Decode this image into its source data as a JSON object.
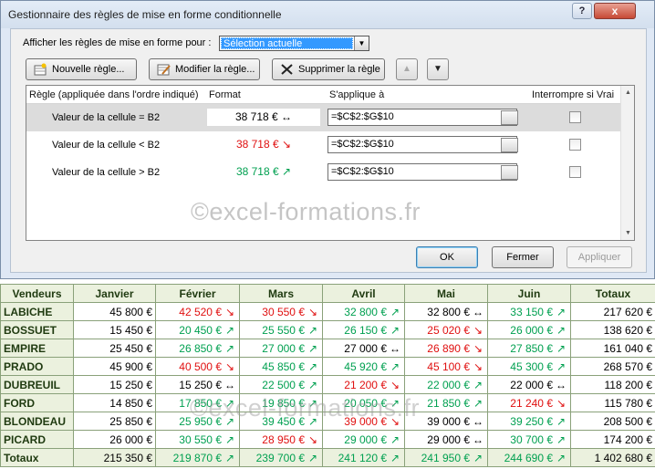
{
  "dialog": {
    "title": "Gestionnaire des règles de mise en forme conditionnelle",
    "help_label": "?",
    "close_label": "x",
    "show_rules_label": "Afficher les règles de mise en forme pour :",
    "show_rules_value": "Sélection actuelle",
    "buttons": {
      "new_rule": "Nouvelle règle...",
      "edit_rule": "Modifier la règle...",
      "delete_rule": "Supprimer la règle",
      "ok": "OK",
      "close": "Fermer",
      "apply": "Appliquer"
    },
    "columns": {
      "rule": "Règle (appliquée dans l'ordre indiqué)",
      "format": "Format",
      "applies_to": "S'applique à",
      "stop_if_true": "Interrompre si Vrai"
    },
    "rules": [
      {
        "rule": "Valeur de la cellule = B2",
        "format_text": "38 718 € ↔",
        "format_color": "#000000",
        "applies_to": "=$C$2:$G$10"
      },
      {
        "rule": "Valeur de la cellule < B2",
        "format_text": "38 718 € ↘",
        "format_color": "#e01010",
        "applies_to": "=$C$2:$G$10"
      },
      {
        "rule": "Valeur de la cellule > B2",
        "format_text": "38 718 € ↗",
        "format_color": "#00a050",
        "applies_to": "=$C$2:$G$10"
      }
    ]
  },
  "watermark": "©excel-formations.fr",
  "table": {
    "headers": [
      "Vendeurs",
      "Janvier",
      "Février",
      "Mars",
      "Avril",
      "Mai",
      "Juin",
      "Totaux"
    ],
    "rows": [
      {
        "name": "LABICHE",
        "cells": [
          [
            "45 800 €",
            ""
          ],
          [
            "42 520 €",
            "↘"
          ],
          [
            "30 550 €",
            "↘"
          ],
          [
            "32 800 €",
            "↗"
          ],
          [
            "32 800 €",
            "↔"
          ],
          [
            "33 150 €",
            "↗"
          ]
        ],
        "total": "217 620 €"
      },
      {
        "name": "BOSSUET",
        "cells": [
          [
            "15 450 €",
            ""
          ],
          [
            "20 450 €",
            "↗"
          ],
          [
            "25 550 €",
            "↗"
          ],
          [
            "26 150 €",
            "↗"
          ],
          [
            "25 020 €",
            "↘"
          ],
          [
            "26 000 €",
            "↗"
          ]
        ],
        "total": "138 620 €"
      },
      {
        "name": "EMPIRE",
        "cells": [
          [
            "25 450 €",
            ""
          ],
          [
            "26 850 €",
            "↗"
          ],
          [
            "27 000 €",
            "↗"
          ],
          [
            "27 000 €",
            "↔"
          ],
          [
            "26 890 €",
            "↘"
          ],
          [
            "27 850 €",
            "↗"
          ]
        ],
        "total": "161 040 €"
      },
      {
        "name": "PRADO",
        "cells": [
          [
            "45 900 €",
            ""
          ],
          [
            "40 500 €",
            "↘"
          ],
          [
            "45 850 €",
            "↗"
          ],
          [
            "45 920 €",
            "↗"
          ],
          [
            "45 100 €",
            "↘"
          ],
          [
            "45 300 €",
            "↗"
          ]
        ],
        "total": "268 570 €"
      },
      {
        "name": "DUBREUIL",
        "cells": [
          [
            "15 250 €",
            ""
          ],
          [
            "15 250 €",
            "↔"
          ],
          [
            "22 500 €",
            "↗"
          ],
          [
            "21 200 €",
            "↘"
          ],
          [
            "22 000 €",
            "↗"
          ],
          [
            "22 000 €",
            "↔"
          ]
        ],
        "total": "118 200 €"
      },
      {
        "name": "FORD",
        "cells": [
          [
            "14 850 €",
            ""
          ],
          [
            "17 850 €",
            "↗"
          ],
          [
            "19 850 €",
            "↗"
          ],
          [
            "20 050 €",
            "↗"
          ],
          [
            "21 850 €",
            "↗"
          ],
          [
            "21 240 €",
            "↘"
          ]
        ],
        "total": "115 780 €"
      },
      {
        "name": "BLONDEAU",
        "cells": [
          [
            "25 850 €",
            ""
          ],
          [
            "25 950 €",
            "↗"
          ],
          [
            "39 450 €",
            "↗"
          ],
          [
            "39 000 €",
            "↘"
          ],
          [
            "39 000 €",
            "↔"
          ],
          [
            "39 250 €",
            "↗"
          ]
        ],
        "total": "208 500 €"
      },
      {
        "name": "PICARD",
        "cells": [
          [
            "26 000 €",
            ""
          ],
          [
            "30 550 €",
            "↗"
          ],
          [
            "28 950 €",
            "↘"
          ],
          [
            "29 000 €",
            "↗"
          ],
          [
            "29 000 €",
            "↔"
          ],
          [
            "30 700 €",
            "↗"
          ]
        ],
        "total": "174 200 €"
      }
    ],
    "totals": {
      "name": "Totaux",
      "cells": [
        [
          "215 350 €",
          ""
        ],
        [
          "219 870 €",
          "↗"
        ],
        [
          "239 700 €",
          "↗"
        ],
        [
          "241 120 €",
          "↗"
        ],
        [
          "241 950 €",
          "↗"
        ],
        [
          "244 690 €",
          "↗"
        ]
      ],
      "total": "1 402 680 €"
    }
  }
}
